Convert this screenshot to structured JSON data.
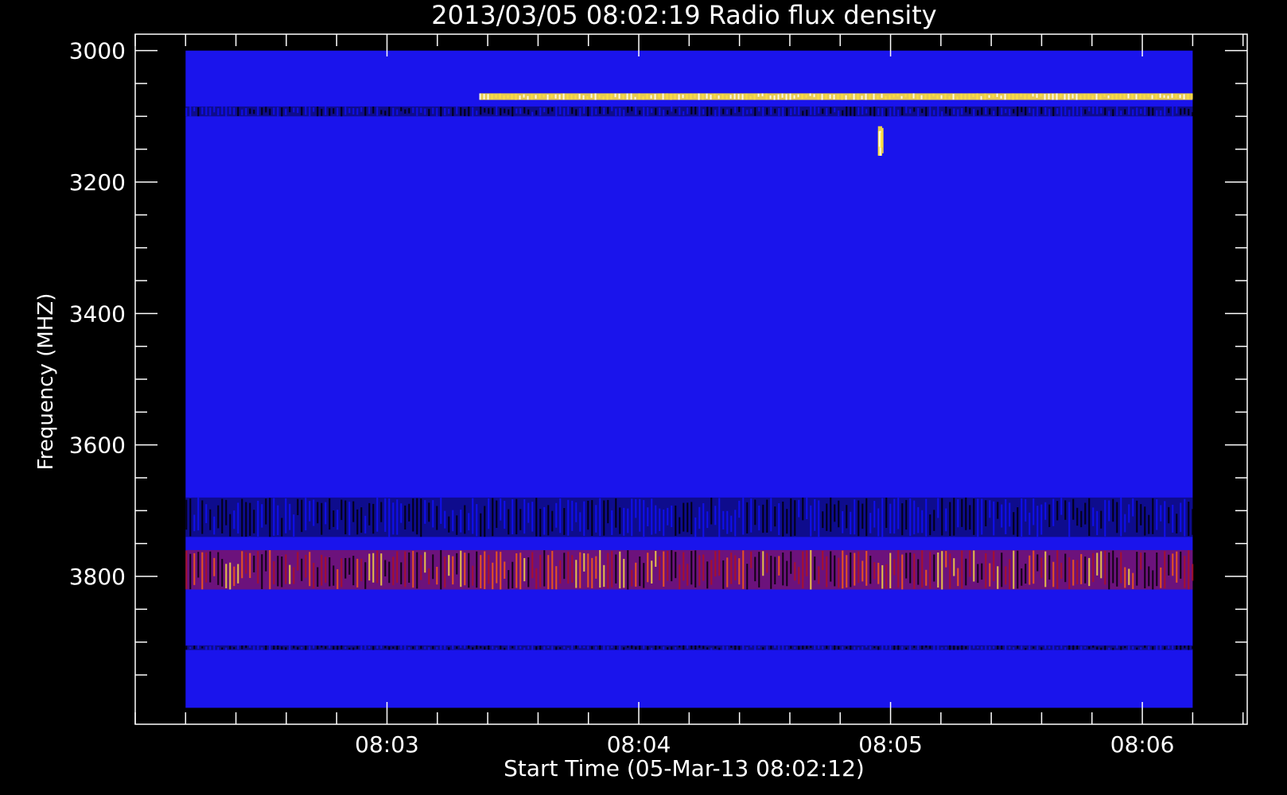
{
  "chart_data": {
    "type": "heatmap",
    "title": "2013/03/05 08:02:19 Radio flux density",
    "xlabel": "Start Time (05-Mar-13 08:02:12)",
    "ylabel": "Frequency (MHZ)",
    "x_ticks": [
      "08:03",
      "08:04",
      "08:05",
      "08:06"
    ],
    "x_tick_values_sec": [
      48,
      108,
      168,
      228
    ],
    "x_data_range_sec": [
      0,
      240
    ],
    "x_axis_range_sec": [
      -12,
      253
    ],
    "y_ticks": [
      "3000",
      "3200",
      "3400",
      "3600",
      "3800"
    ],
    "y_tick_values": [
      3000,
      3200,
      3400,
      3600,
      3800
    ],
    "y_data_range": [
      3000,
      4000
    ],
    "y_axis_range": [
      2975,
      4025
    ],
    "y_reversed": true,
    "grid": false,
    "colormap": [
      "#000000",
      "#1010ff",
      "#b01020",
      "#ff6010",
      "#ffe040",
      "#ffffff"
    ],
    "background_level_color": "#1a14ec",
    "features": [
      {
        "label": "narrow bright band",
        "freq_mhz": [
          3065,
          3075
        ],
        "time_sec": [
          70,
          240
        ]
      },
      {
        "label": "dark band",
        "freq_mhz": [
          3085,
          3100
        ],
        "time_sec": [
          0,
          240
        ]
      },
      {
        "label": "spike",
        "freq_mhz": [
          3115,
          3160
        ],
        "time_sec": [
          165,
          166
        ]
      },
      {
        "label": "dark banded region",
        "freq_mhz": [
          3680,
          3740
        ],
        "time_sec": [
          0,
          240
        ]
      },
      {
        "label": "emission band",
        "freq_mhz": [
          3760,
          3820
        ],
        "time_sec": [
          0,
          240
        ]
      },
      {
        "label": "dark line",
        "freq_mhz": [
          3905,
          3912
        ],
        "time_sec": [
          0,
          240
        ]
      }
    ]
  }
}
